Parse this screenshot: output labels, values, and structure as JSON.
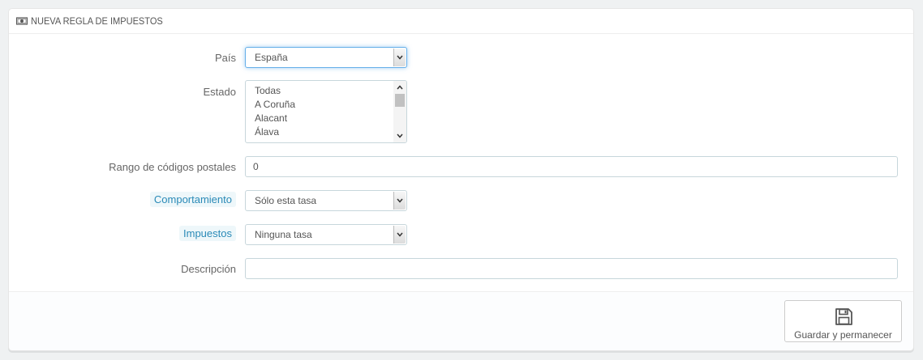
{
  "panel": {
    "title": "NUEVA REGLA DE IMPUESTOS",
    "title_icon": "money-icon"
  },
  "form": {
    "pais": {
      "label": "País",
      "value": "España"
    },
    "estado": {
      "label": "Estado",
      "options": [
        "Todas",
        "A Coruña",
        "Alacant",
        "Álava"
      ]
    },
    "codigos_postales": {
      "label": "Rango de códigos postales",
      "value": "0"
    },
    "comportamiento": {
      "label": "Comportamiento",
      "value": "Sólo esta tasa"
    },
    "impuestos": {
      "label": "Impuestos",
      "value": "Ninguna tasa"
    },
    "descripcion": {
      "label": "Descripción",
      "value": ""
    }
  },
  "footer": {
    "save_label": "Guardar y permanecer",
    "save_icon": "floppy-disk-icon"
  },
  "colors": {
    "hint_label_bg": "#eef7fa",
    "hint_label_text": "#2a8ab7",
    "focus_border": "#66afe9"
  }
}
